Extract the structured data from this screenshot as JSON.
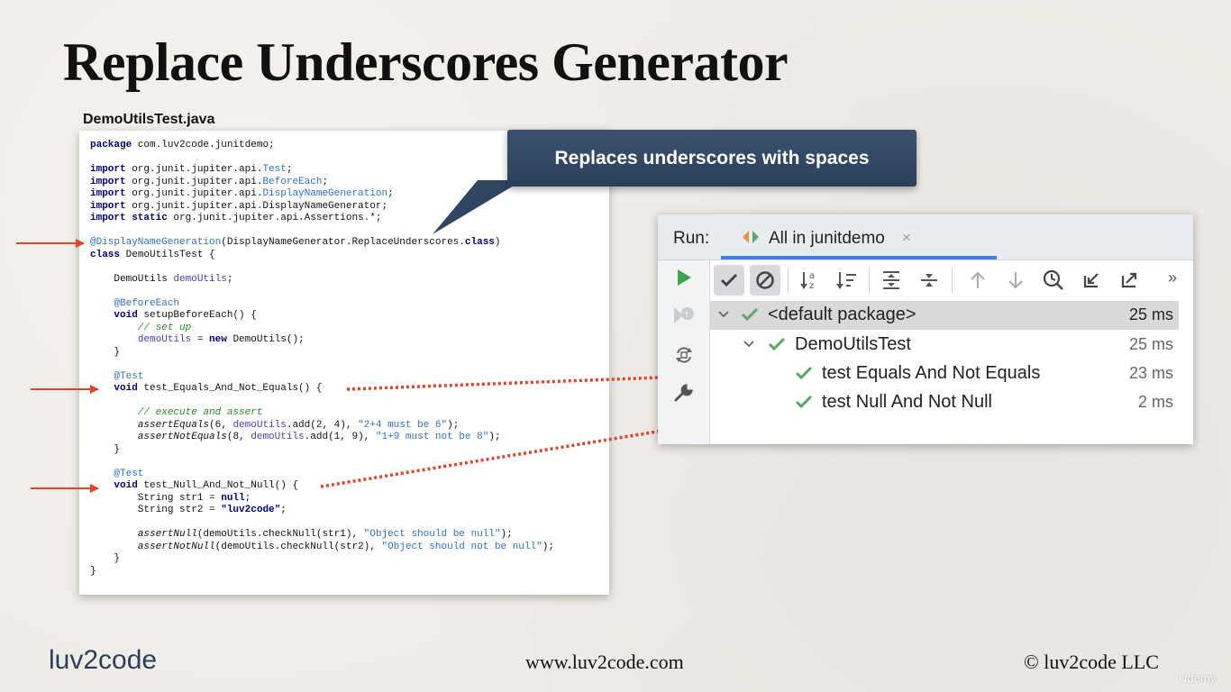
{
  "slide": {
    "title": "Replace Underscores Generator",
    "file_label": "DemoUtilsTest.java"
  },
  "code": {
    "line01_kw": "package",
    "line01_rest": " com.luv2code.junitdemo;",
    "imports": [
      {
        "kw": "import",
        "prefix": " org.junit.jupiter.api.",
        "hl": "Test",
        "suffix": ";"
      },
      {
        "kw": "import",
        "prefix": " org.junit.jupiter.api.",
        "hl": "BeforeEach",
        "suffix": ";"
      },
      {
        "kw": "import",
        "prefix": " org.junit.jupiter.api.",
        "hl": "DisplayNameGeneration",
        "suffix": ";"
      },
      {
        "kw": "import",
        "prefix": " org.junit.jupiter.api.DisplayNameGenerator;",
        "hl": "",
        "suffix": ""
      },
      {
        "kw": "import static",
        "prefix": " org.junit.jupiter.api.Assertions.*;",
        "hl": "",
        "suffix": ""
      }
    ],
    "annotation": "@DisplayNameGeneration",
    "annotation_args_a": "(DisplayNameGenerator.ReplaceUnderscores.",
    "annotation_args_kw": "class",
    "annotation_args_b": ")",
    "class_kw": "class",
    "class_decl": " DemoUtilsTest {",
    "field_type": "    DemoUtils ",
    "field_name": "demoUtils",
    "field_end": ";",
    "before_each": "    @BeforeEach",
    "void_kw": "void",
    "setup_sig": " setupBeforeEach() {",
    "comment_setup": "        // set up",
    "setup_assign_a": "demoUtils",
    "setup_assign_b": " = ",
    "new_kw": "new",
    "setup_assign_c": " DemoUtils();",
    "close_brace_indented": "    }",
    "test_annotation": "    @Test",
    "test1_sig": " test_Equals_And_Not_Equals() {",
    "comment_exec": "        // execute and assert",
    "assert_equals": "assertEquals",
    "ae_args_a": "(6, ",
    "ae_field": "demoUtils",
    "ae_args_b": ".add(2, 4), ",
    "ae_msg": "\"2+4 must be 6\"",
    "ae_end": ");",
    "assert_not_equals": "assertNotEquals",
    "ane_args_a": "(8, ",
    "ane_args_b": ".add(1, 9), ",
    "ane_msg": "\"1+9 must not be 8\"",
    "test2_sig": " test_Null_And_Not_Null() {",
    "str1_a": "        String str1 = ",
    "null_kw": "null",
    "str2_a": "        String str2 = ",
    "str2_val": "\"luv2code\"",
    "assert_null": "assertNull",
    "an_args": "(demoUtils.checkNull(str1), ",
    "an_msg": "\"Object should be null\"",
    "assert_not_null": "assertNotNull",
    "ann_args": "(demoUtils.checkNull(str2), ",
    "ann_msg": "\"Object should not be null\"",
    "close_brace": "}"
  },
  "callout": {
    "text": "Replaces underscores with spaces"
  },
  "run_panel": {
    "run_label": "Run:",
    "tab_label": "All in junitdemo",
    "tab_close": "×",
    "more": "»",
    "tree": [
      {
        "label": "<default package>",
        "time": "25 ms",
        "selected": true
      },
      {
        "label": "DemoUtilsTest",
        "time": "25 ms",
        "selected": false
      },
      {
        "label": "test Equals And Not Equals",
        "time": "23 ms",
        "selected": false
      },
      {
        "label": "test Null And Not Null",
        "time": "2 ms",
        "selected": false
      }
    ],
    "colors": {
      "pass": "#59a869",
      "run": "#3fa34d",
      "accent": "#3f7fe0"
    }
  },
  "footer": {
    "logo": "luv2code",
    "site": "www.luv2code.com",
    "copyright": "© luv2code LLC",
    "watermark": "Udemy"
  }
}
